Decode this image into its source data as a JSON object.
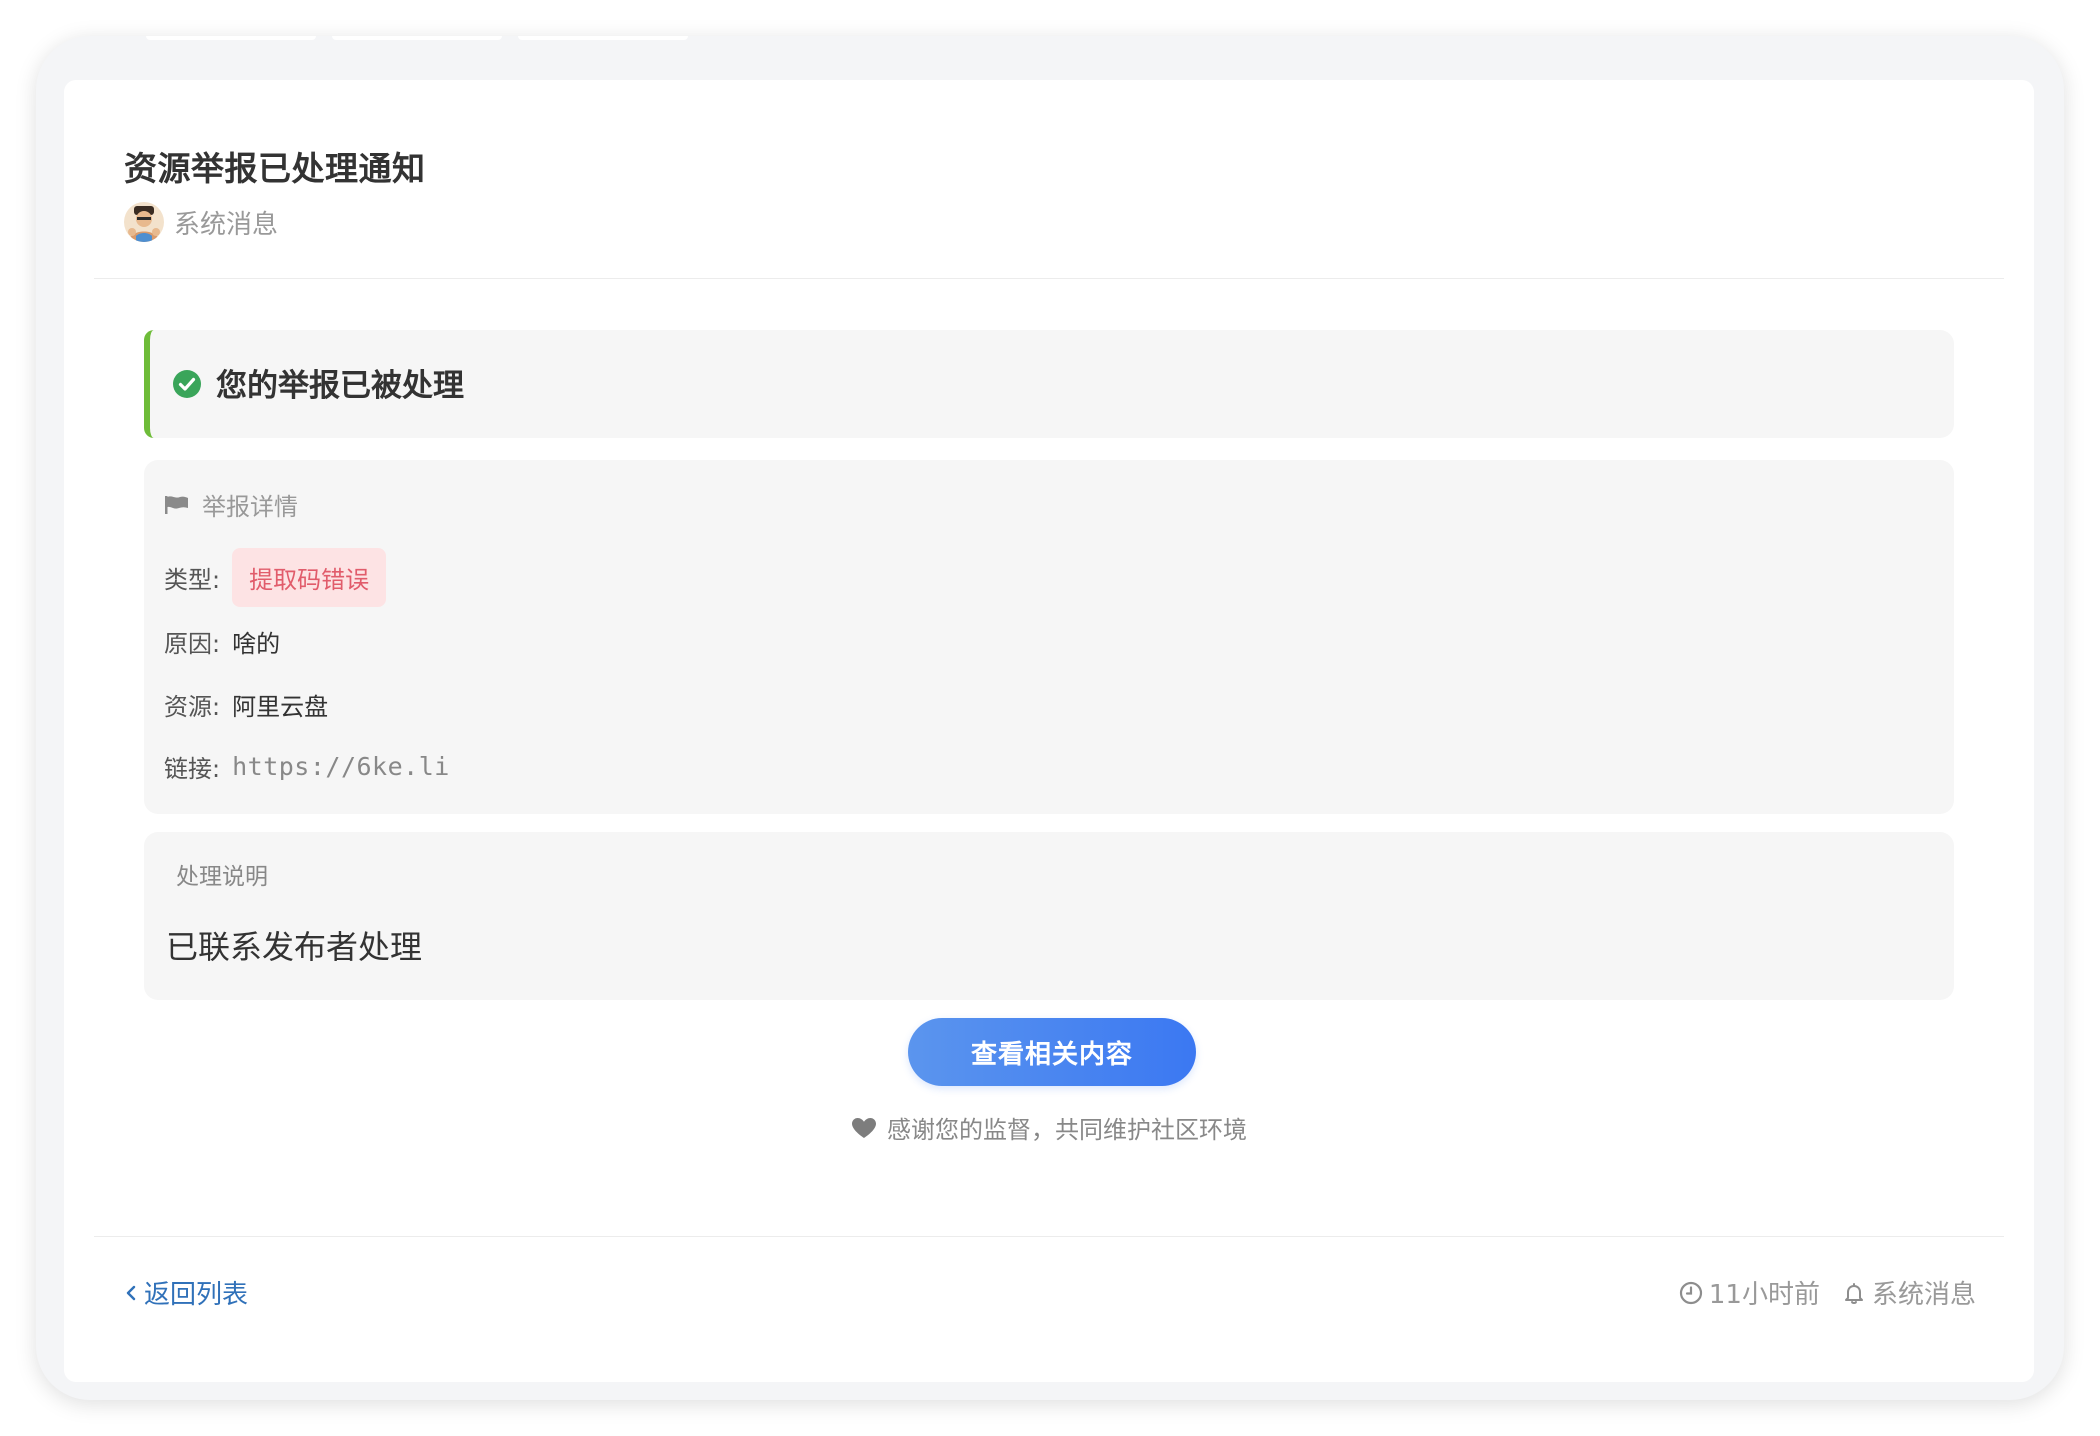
{
  "notice": {
    "title": "资源举报已处理通知",
    "author": "系统消息"
  },
  "status": {
    "text": "您的举报已被处理",
    "color": "#6ebc39"
  },
  "details": {
    "header": "举报详情",
    "type_label": "类型:",
    "type_value": "提取码错误",
    "reason_label": "原因:",
    "reason_value": "啥的",
    "resource_label": "资源:",
    "resource_value": "阿里云盘",
    "link_label": "链接:",
    "link_value": "https://6ke.li"
  },
  "explain": {
    "header": "处理说明",
    "text": "已联系发布者处理"
  },
  "action": {
    "view_button": "查看相关内容",
    "accent": "#3b78f2"
  },
  "thanks": {
    "text": "感谢您的监督，共同维护社区环境"
  },
  "footer": {
    "back_label": "返回列表",
    "time": "11小时前",
    "category": "系统消息"
  },
  "icons": [
    "check-circle-icon",
    "flag-icon",
    "heart-icon",
    "chevron-left-icon",
    "clock-icon",
    "bell-icon"
  ]
}
